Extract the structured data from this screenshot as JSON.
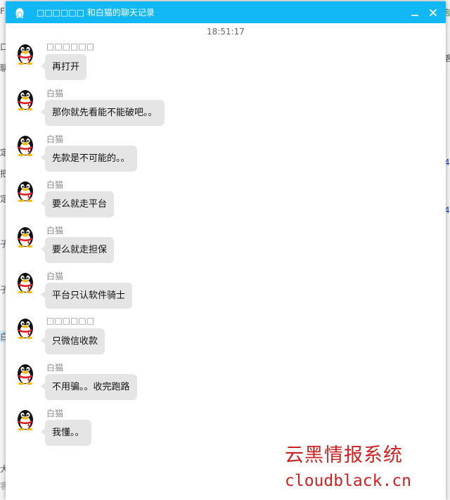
{
  "background_app": {
    "left_fragments": [
      "F",
      "口",
      "聊",
      "定",
      "把",
      "定",
      "子",
      "子",
      "白",
      "大",
      "客"
    ],
    "right_fragments": [
      "部",
      "客",
      "4",
      "4"
    ]
  },
  "window": {
    "title": "□□□□□□ 和白猫的聊天记录",
    "minimize_label": "—",
    "close_label": "✕",
    "titlebar_color": "#12b7f5"
  },
  "chat": {
    "timestamp": "18:51:17",
    "messages": [
      {
        "sender": "□□□□□□",
        "text": "再打开"
      },
      {
        "sender": "白猫",
        "text": "那你就先看能不能破吧。。"
      },
      {
        "sender": "白猫",
        "text": "先款是不可能的。。"
      },
      {
        "sender": "白猫",
        "text": "要么就走平台"
      },
      {
        "sender": "白猫",
        "text": "要么就走担保"
      },
      {
        "sender": "白猫",
        "text": "平台只认软件骑士"
      },
      {
        "sender": "□□□□□□",
        "text": "只微信收款"
      },
      {
        "sender": "白猫",
        "text": "不用骗。。收完跑路"
      },
      {
        "sender": "白猫",
        "text": "我懂。。"
      }
    ]
  },
  "watermark": {
    "chinese": "云黑情报系统",
    "url": "cloudblack.cn",
    "color": "#cc2222"
  }
}
